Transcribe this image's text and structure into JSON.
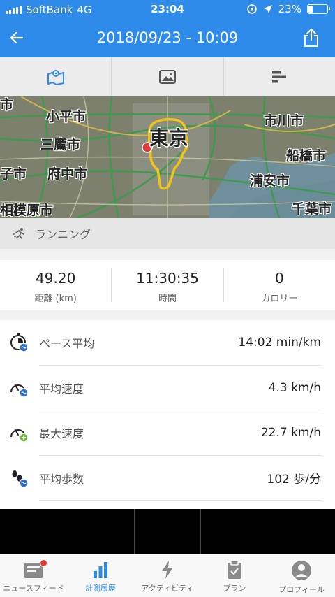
{
  "status_bar": {
    "carrier": "SoftBank",
    "network": "4G",
    "time": "23:04",
    "battery_percent": "23%",
    "battery_level": 0.23
  },
  "header": {
    "title": "2018/09/23 - 10:09"
  },
  "tabs": [
    {
      "icon": "map-icon",
      "active": true
    },
    {
      "icon": "photo-icon",
      "active": false
    },
    {
      "icon": "bar-chart-icon",
      "active": false
    }
  ],
  "map": {
    "labels": [
      "小平市",
      "三鷹市",
      "府中市",
      "相模原市",
      "東京",
      "市川市",
      "船橋市",
      "浦安市",
      "千葉市"
    ],
    "partial_labels": [
      "市",
      "子市"
    ]
  },
  "activity": {
    "type": "ランニング"
  },
  "summary": [
    {
      "value": "49.20",
      "label": "距離 (km)"
    },
    {
      "value": "11:30:35",
      "label": "時間"
    },
    {
      "value": "0",
      "label": "カロリー"
    }
  ],
  "metrics": [
    {
      "icon": "pace-icon",
      "name": "ペース平均",
      "value": "14:02 min/km"
    },
    {
      "icon": "avg-speed-icon",
      "name": "平均速度",
      "value": "4.3 km/h"
    },
    {
      "icon": "max-speed-icon",
      "name": "最大速度",
      "value": "22.7 km/h"
    },
    {
      "icon": "steps-icon",
      "name": "平均歩数",
      "value": "102 歩/分"
    }
  ],
  "bottom_nav": [
    {
      "label": "ニュースフィード",
      "icon": "newsfeed-icon",
      "active": false,
      "badge": true
    },
    {
      "label": "計測履歴",
      "icon": "history-icon",
      "active": true
    },
    {
      "label": "アクティビティ",
      "icon": "activity-bolt-icon",
      "active": false
    },
    {
      "label": "プラン",
      "icon": "plan-clipboard-icon",
      "active": false
    },
    {
      "label": "プロフィール",
      "icon": "profile-icon",
      "active": false
    }
  ],
  "colors": {
    "brand": "#2f8bea",
    "route": "#f0c419",
    "start_marker": "#e53935"
  }
}
